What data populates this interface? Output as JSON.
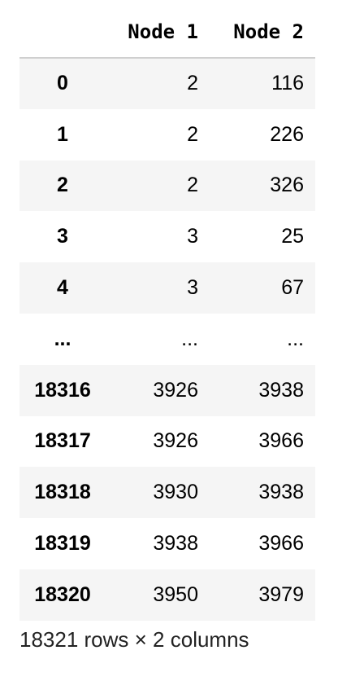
{
  "table": {
    "columns": [
      "Node 1",
      "Node 2"
    ],
    "rows": [
      {
        "index": "0",
        "values": [
          "2",
          "116"
        ]
      },
      {
        "index": "1",
        "values": [
          "2",
          "226"
        ]
      },
      {
        "index": "2",
        "values": [
          "2",
          "326"
        ]
      },
      {
        "index": "3",
        "values": [
          "3",
          "25"
        ]
      },
      {
        "index": "4",
        "values": [
          "3",
          "67"
        ]
      },
      {
        "index": "...",
        "values": [
          "...",
          "..."
        ]
      },
      {
        "index": "18316",
        "values": [
          "3926",
          "3938"
        ]
      },
      {
        "index": "18317",
        "values": [
          "3926",
          "3966"
        ]
      },
      {
        "index": "18318",
        "values": [
          "3930",
          "3938"
        ]
      },
      {
        "index": "18319",
        "values": [
          "3938",
          "3966"
        ]
      },
      {
        "index": "18320",
        "values": [
          "3950",
          "3979"
        ]
      }
    ]
  },
  "footer": "18321 rows × 2 columns"
}
